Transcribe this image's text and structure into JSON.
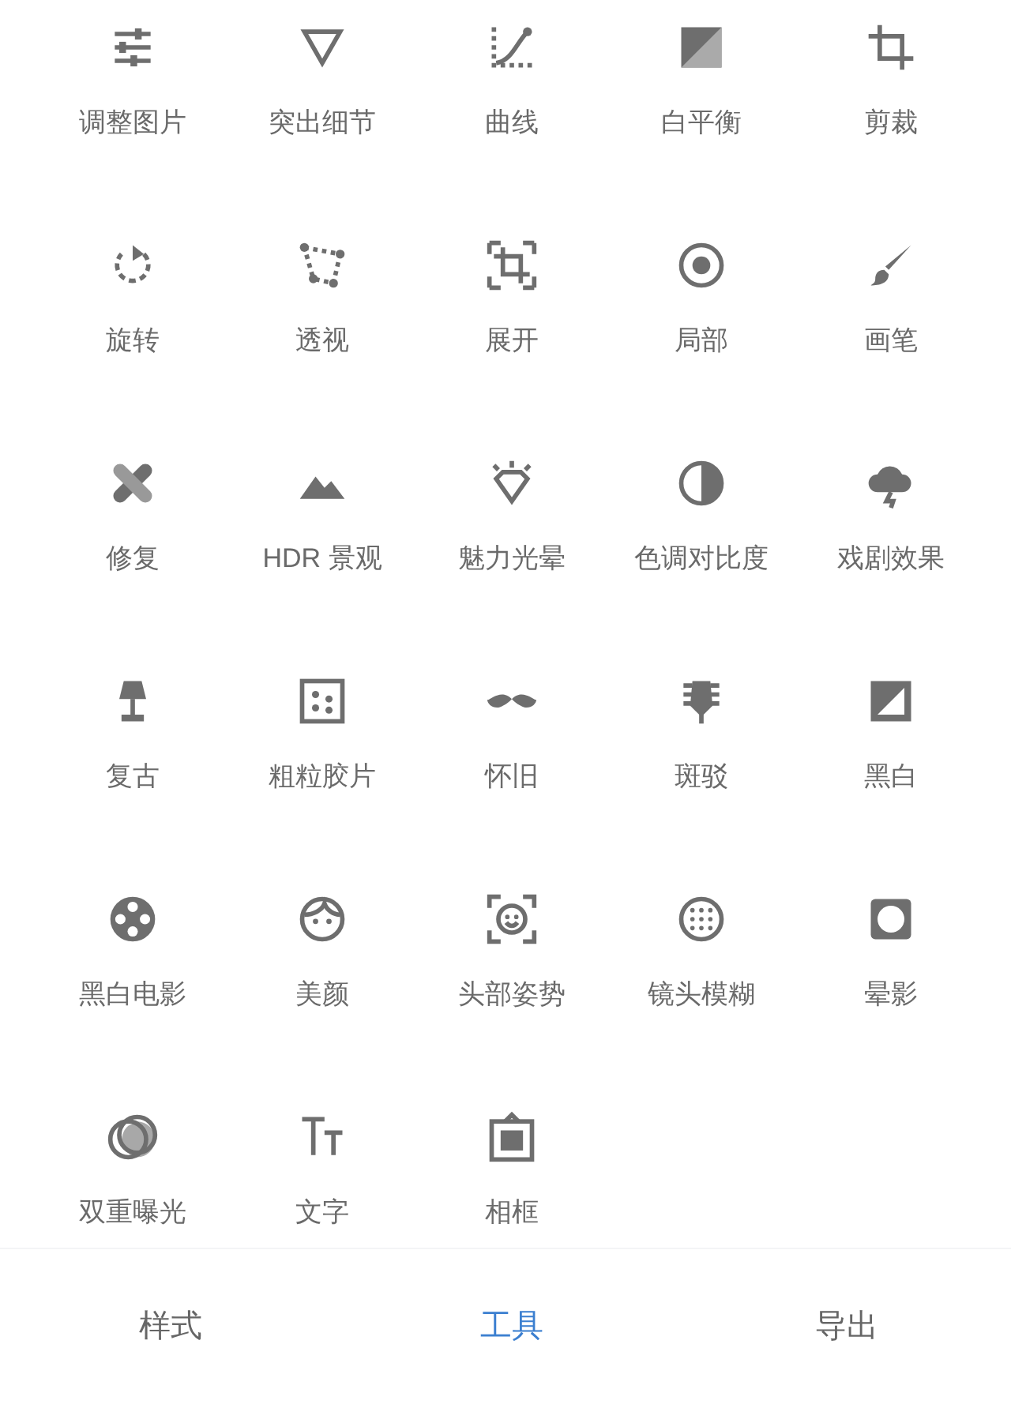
{
  "tools": [
    {
      "label": "调整图片"
    },
    {
      "label": "突出细节"
    },
    {
      "label": "曲线"
    },
    {
      "label": "白平衡"
    },
    {
      "label": "剪裁"
    },
    {
      "label": "旋转"
    },
    {
      "label": "透视"
    },
    {
      "label": "展开"
    },
    {
      "label": "局部"
    },
    {
      "label": "画笔"
    },
    {
      "label": "修复"
    },
    {
      "label": "HDR 景观"
    },
    {
      "label": "魅力光晕"
    },
    {
      "label": "色调对比度"
    },
    {
      "label": "戏剧效果"
    },
    {
      "label": "复古"
    },
    {
      "label": "粗粒胶片"
    },
    {
      "label": "怀旧"
    },
    {
      "label": "斑驳"
    },
    {
      "label": "黑白"
    },
    {
      "label": "黑白电影"
    },
    {
      "label": "美颜"
    },
    {
      "label": "头部姿势"
    },
    {
      "label": "镜头模糊"
    },
    {
      "label": "晕影"
    },
    {
      "label": "双重曝光"
    },
    {
      "label": "文字"
    },
    {
      "label": "相框"
    }
  ],
  "bottom_tabs": [
    {
      "label": "样式",
      "selected": false
    },
    {
      "label": "工具",
      "selected": true
    },
    {
      "label": "导出",
      "selected": false
    }
  ]
}
